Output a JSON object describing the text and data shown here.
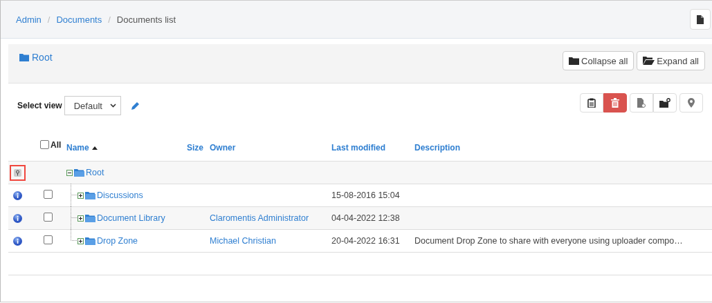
{
  "breadcrumb": [
    {
      "label": "Admin",
      "link": true
    },
    {
      "separator": "/",
      "label": "Documents",
      "link": true
    },
    {
      "separator": "/",
      "label": "Documents list",
      "link": false
    }
  ],
  "panel": {
    "title": "Root",
    "buttons": [
      {
        "label": "Collapse all",
        "kind": "collapse"
      },
      {
        "label": "Expand all",
        "kind": "expand"
      }
    ]
  },
  "select_view": {
    "label": "Select view",
    "value": "Default"
  },
  "toolbar": [
    {
      "kind": "clipboard",
      "danger": false
    },
    {
      "kind": "trash",
      "danger": true
    },
    {
      "kind": "file",
      "danger": false
    },
    {
      "kind": "folder",
      "danger": false
    },
    {
      "kind": "pin",
      "danger": false
    }
  ],
  "table": {
    "select_all": {
      "label": "All",
      "checked": false
    },
    "columns": [
      {
        "label": "Name",
        "sorted": true
      },
      {
        "label": "Size",
        "sorted": false
      },
      {
        "label": "Owner",
        "sorted": false
      },
      {
        "label": "Last modified",
        "sorted": false
      },
      {
        "label": "Description",
        "sorted": false
      }
    ],
    "tree": [
      {
        "name": "Root",
        "highlighted": true,
        "expanded": true,
        "children": [
          {
            "name": "Discussions",
            "checked": false,
            "expanded": false,
            "modified": "15-08-2016 15:04"
          },
          {
            "name": "Document Library",
            "checked": false,
            "expanded": false,
            "owner": "Claromentis Administrator",
            "modified": "04-04-2022 12:38"
          },
          {
            "name": "Drop Zone",
            "checked": false,
            "expanded": false,
            "owner": "Michael Christian",
            "modified": "20-04-2022 16:31",
            "description": "Document Drop Zone to share with everyone using uploader compo…"
          }
        ]
      }
    ]
  }
}
